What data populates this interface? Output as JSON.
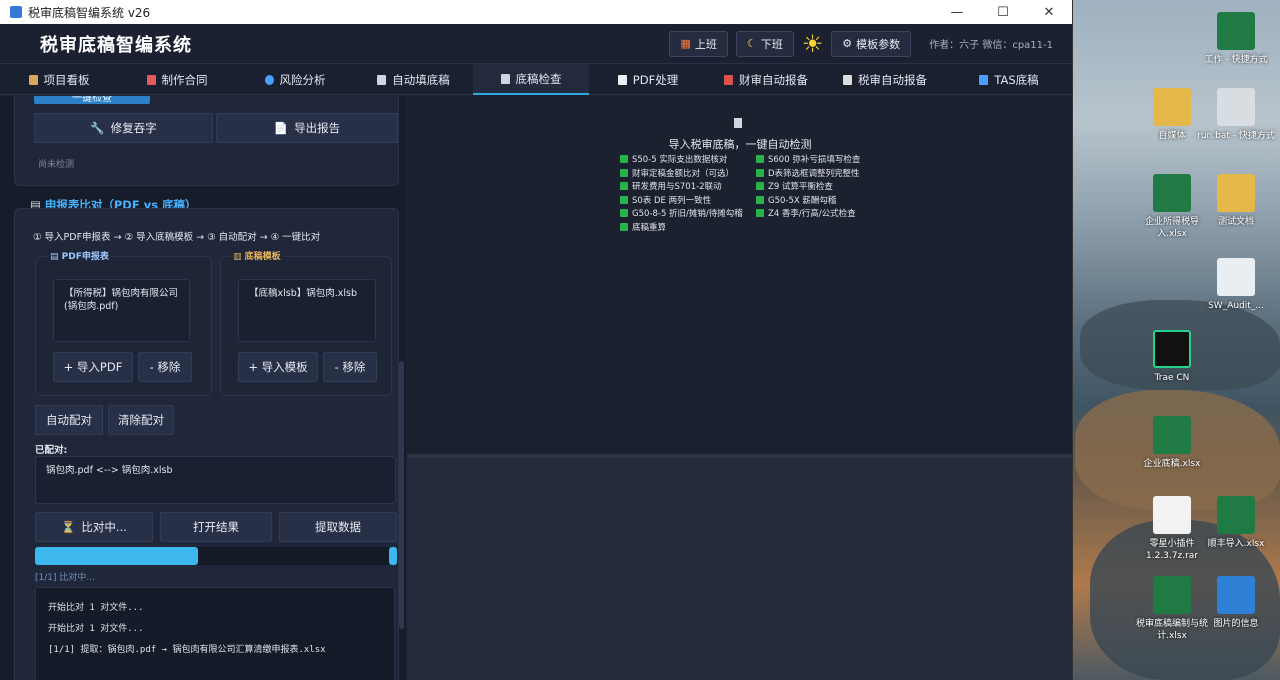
{
  "window": {
    "title": "税审底稿智编系统 v26",
    "minimize": "—",
    "maximize": "☐",
    "close": "✕"
  },
  "header": {
    "title": "税审底稿智编系统",
    "btn_on": "上班",
    "btn_off": "下班",
    "sun": "☀",
    "template_params": "模板参数",
    "author": "作者：六子  微信：cpa11-1"
  },
  "tabs": [
    {
      "label": "项目看板",
      "color": "#d7a75e"
    },
    {
      "label": "制作合同",
      "color": "#f2f2f2"
    },
    {
      "label": "风险分析",
      "color": "#4aa0ff"
    },
    {
      "label": "自动填底稿",
      "color": "#f2f2f2"
    },
    {
      "label": "底稿检查",
      "color": "#f2f2f2"
    },
    {
      "label": "PDF处理",
      "color": "#f2f2f2"
    },
    {
      "label": "财审自动报备",
      "color": "#e05050"
    },
    {
      "label": "税审自动报备",
      "color": "#dddddd"
    },
    {
      "label": "TAS底稿",
      "color": "#4aa0ff"
    }
  ],
  "left": {
    "check_all": "一键检查",
    "fix_glyph": "修复吞字",
    "export_report": "导出报告",
    "not_checked": "尚未检测",
    "compare_title": "申报表比对（PDF vs 底稿）",
    "steps": "① 导入PDF申报表 → ② 导入底稿模板 → ③ 自动配对 → ④ 一键比对",
    "pdf_group": "PDF申报表",
    "pdf_file": "【所得税】锅包肉有限公司(锅包肉.pdf)",
    "import_pdf": "+ 导入PDF",
    "remove1": "- 移除",
    "tpl_group": "底稿模板",
    "tpl_file": "【底稿xlsb】锅包肉.xlsb",
    "import_tpl": "+ 导入模板",
    "remove2": "- 移除",
    "auto_pair": "自动配对",
    "clear_pair": "清除配对",
    "paired_label": "已配对:",
    "pair_item": "锅包肉.pdf  <-->  锅包肉.xlsb",
    "comparing": "比对中...",
    "open_result": "打开结果",
    "extract_data": "提取数据",
    "progress": 0.45,
    "progress_text": "[1/1] 比对中...",
    "log": [
      "开始比对 1 对文件...",
      "开始比对 1 对文件...",
      "[1/1] 提取：锅包肉.pdf → 锅包肉有限公司汇算清缴申报表.xlsx"
    ]
  },
  "right": {
    "heading": "导入税审底稿，一键自动检测",
    "col1": [
      "S50-5 实际支出数据核对",
      "财审定稿金额比对（可选）",
      "研发费用与S701-2联动",
      "S0表 DE 两列一致性",
      "G50-8-5 折旧/摊销/待摊勾稽",
      "底稿重算"
    ],
    "col2": [
      "S600 弥补亏损填写检查",
      "D表筛选框调整列完整性",
      "Z9 试算平衡检查",
      "G50-5X 薪酬勾稽",
      "Z4 香李/行高/公式检查"
    ]
  },
  "desktop": [
    {
      "label": "工作 - 快捷方式",
      "kind": "excel"
    },
    {
      "label": "自媒体",
      "kind": "folder"
    },
    {
      "label": "run.bat - 快捷方式",
      "kind": "gear"
    },
    {
      "label": "企业所得税导入.xlsx",
      "kind": "excel"
    },
    {
      "label": "测试文档",
      "kind": "folder"
    },
    {
      "label": "SW_Audit_...",
      "kind": "download"
    },
    {
      "label": "Trae CN",
      "kind": "trae"
    },
    {
      "label": "企业底稿.xlsx",
      "kind": "excel"
    },
    {
      "label": "零星小插件 1.2.3.7z.rar",
      "kind": "file"
    },
    {
      "label": "顺丰导入.xlsx",
      "kind": "excel"
    },
    {
      "label": "税审底稿编制与统计.xlsx",
      "kind": "excel"
    },
    {
      "label": "图片的信息",
      "kind": "image"
    }
  ]
}
